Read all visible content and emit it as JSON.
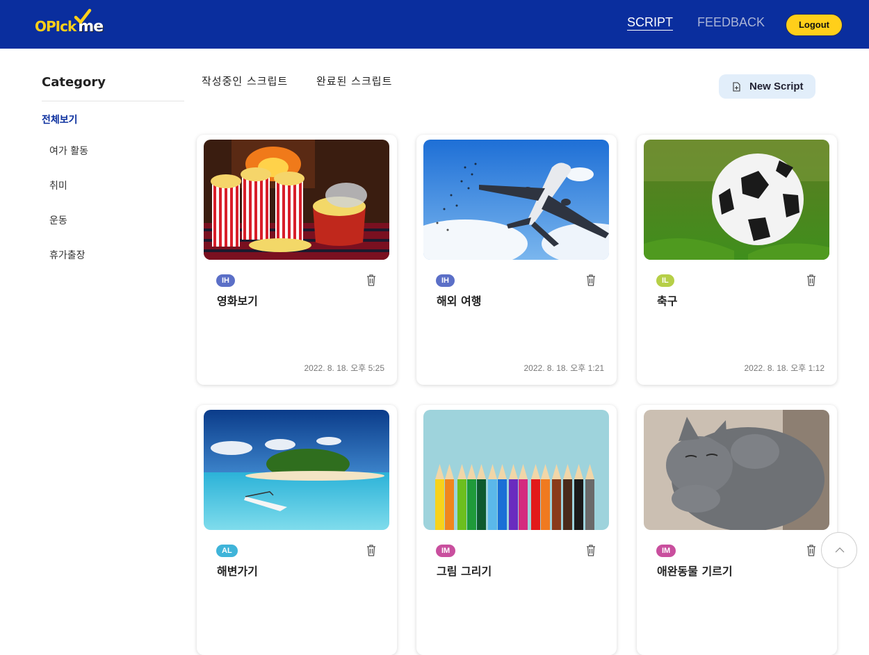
{
  "header": {
    "logo_text": "OPIck",
    "logo_text_me": "me",
    "nav_script": "SCRIPT",
    "nav_feedback": "FEEDBACK",
    "logout_label": "Logout",
    "bg_color": "#0a2e9e",
    "accent_color": "#ffcf1a"
  },
  "sidebar": {
    "title": "Category",
    "all": "전체보기",
    "items": [
      "여가 활동",
      "취미",
      "운동",
      "휴가출장"
    ]
  },
  "tabs": {
    "in_progress": "작성중인 스크립트",
    "completed": "완료된 스크립트"
  },
  "new_script_label": "New Script",
  "cards": [
    {
      "level": "IH",
      "level_color": "#5b6fc7",
      "title": "영화보기",
      "date": "2022. 8. 18. 오후 5:25",
      "image": "popcorn-image"
    },
    {
      "level": "IH",
      "level_color": "#5b6fc7",
      "title": "해외 여행",
      "date": "2022. 8. 18. 오후 1:21",
      "image": "airplane-image"
    },
    {
      "level": "IL",
      "level_color": "#b6cf47",
      "title": "축구",
      "date": "2022. 8. 18. 오후 1:12",
      "image": "soccer-ball-image"
    },
    {
      "level": "AL",
      "level_color": "#3fb4d9",
      "title": "해변가기",
      "date": "",
      "image": "beach-island-image"
    },
    {
      "level": "IM",
      "level_color": "#c94f9e",
      "title": "그림 그리기",
      "date": "",
      "image": "colored-pencils-image"
    },
    {
      "level": "IM",
      "level_color": "#c94f9e",
      "title": "애완동물 기르기",
      "date": "",
      "image": "cat-image"
    }
  ]
}
